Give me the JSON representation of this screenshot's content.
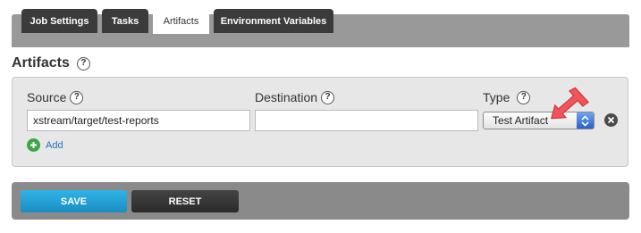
{
  "tabs": [
    {
      "label": "Job Settings",
      "active": false
    },
    {
      "label": "Tasks",
      "active": false
    },
    {
      "label": "Artifacts",
      "active": true
    },
    {
      "label": "Environment Variables",
      "active": false
    }
  ],
  "section": {
    "title": "Artifacts",
    "help_icon": "?"
  },
  "artifact_row": {
    "source_label": "Source",
    "destination_label": "Destination",
    "type_label": "Type",
    "source_value": "xstream/target/test-reports",
    "destination_value": "",
    "type_value": "Test Artifact"
  },
  "add_link": {
    "label": "Add"
  },
  "actions": {
    "save_label": "SAVE",
    "reset_label": "RESET"
  },
  "colors": {
    "tab_bar": "#999999",
    "tab_inactive": "#3b3b3b",
    "save_button": "#1b8dc2",
    "reset_button": "#2b2b2b",
    "add_icon": "#3fa44a",
    "annotation_arrow": "#f2545b"
  },
  "icons": {
    "help": "question-circle-icon",
    "add": "plus-circle-icon",
    "remove": "close-circle-icon",
    "select": "up-down-chevron-icon",
    "annotation": "red-arrow-icon"
  }
}
